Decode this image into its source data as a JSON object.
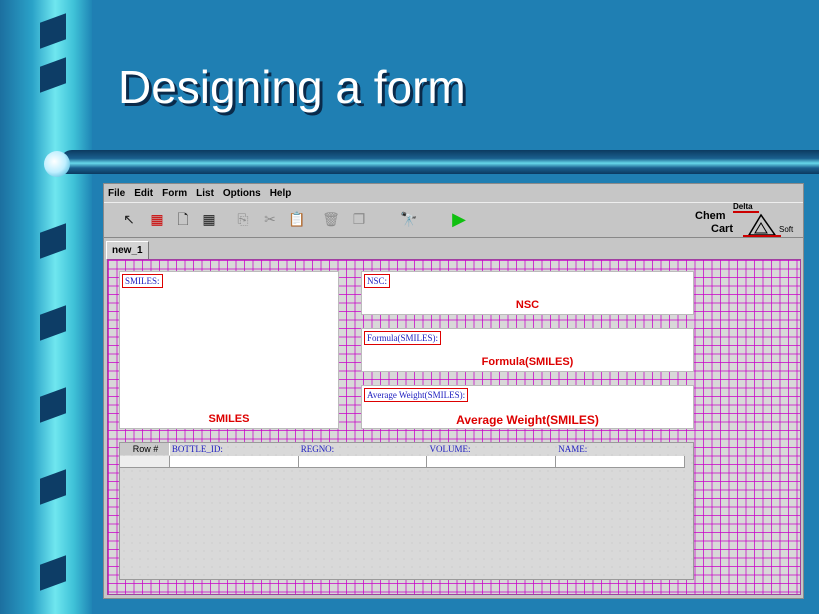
{
  "slide": {
    "title": "Designing a form"
  },
  "menu": [
    "File",
    "Edit",
    "Form",
    "List",
    "Options",
    "Help"
  ],
  "toolbar": {
    "buttons": [
      {
        "icon": "pointer-icon",
        "glyph": "↖",
        "enabled": true
      },
      {
        "icon": "text-field-icon",
        "glyph": "▦",
        "enabled": true
      },
      {
        "icon": "new-document-icon",
        "glyph": "🗋",
        "enabled": true
      },
      {
        "icon": "grid-table-icon",
        "glyph": "▦",
        "enabled": true
      },
      {
        "icon": "copy-icon",
        "glyph": "⎘",
        "enabled": false
      },
      {
        "icon": "cut-icon",
        "glyph": "✂",
        "enabled": false
      },
      {
        "icon": "paste-icon",
        "glyph": "📋",
        "enabled": false
      },
      {
        "icon": "delete-icon",
        "glyph": "🗑",
        "enabled": false
      },
      {
        "icon": "duplicate-icon",
        "glyph": "❐",
        "enabled": false
      },
      {
        "icon": "binoculars-icon",
        "glyph": "🔭",
        "enabled": true
      },
      {
        "icon": "run-icon",
        "glyph": "▶",
        "enabled": true
      }
    ],
    "run_color": "#10c010"
  },
  "logo": {
    "line1": "Chem",
    "line2": "Cart",
    "line3": "Delta",
    "line4": "Soft"
  },
  "tabs": [
    {
      "label": "new_1"
    }
  ],
  "fields": {
    "smiles": {
      "label": "SMILES:",
      "name": "SMILES"
    },
    "nsc": {
      "label": "NSC:",
      "name": "NSC"
    },
    "formula": {
      "label": "Formula(SMILES):",
      "name": "Formula(SMILES)"
    },
    "avg_weight": {
      "label": "Average Weight(SMILES):",
      "name": "Average Weight(SMILES)"
    }
  },
  "grid": {
    "row_header": "Row #",
    "columns": [
      "BOTTLE_ID:",
      "REGNO:",
      "VOLUME:",
      "NAME:"
    ]
  },
  "colors": {
    "label_text": "#2020c0",
    "field_name": "#dd0000",
    "grid_lines": "#c800c8"
  }
}
